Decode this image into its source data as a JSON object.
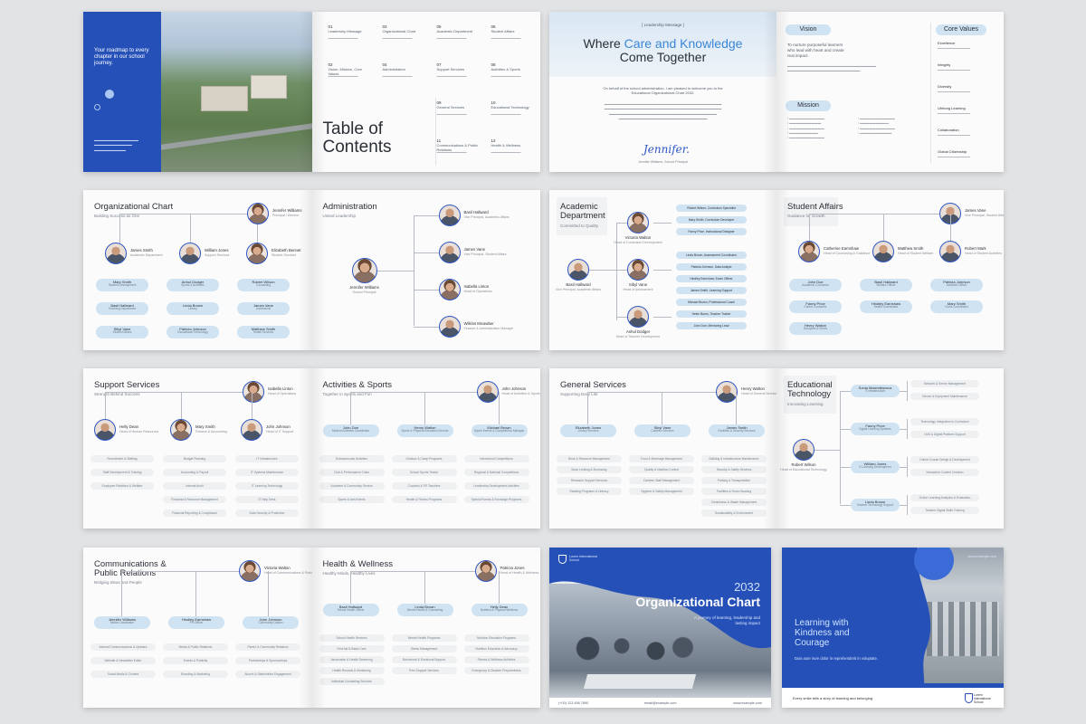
{
  "colors": {
    "accent": "#2450b8",
    "pill": "#cfe3f3",
    "background": "#e2e3e5"
  },
  "toc": {
    "tagline": "Your roadmap to every chapter in our school journey.",
    "title": "Table of Contents",
    "entries": [
      {
        "num": "01",
        "label": "Leadership Message"
      },
      {
        "num": "02",
        "label": "Vision, Mission, Core Values"
      },
      {
        "num": "03",
        "label": "Organizational Chart"
      },
      {
        "num": "04",
        "label": "Administration"
      },
      {
        "num": "05",
        "label": "Academic Department"
      },
      {
        "num": "06",
        "label": "Student Affairs"
      },
      {
        "num": "07",
        "label": "Support Services"
      },
      {
        "num": "08",
        "label": "Activities & Sports"
      },
      {
        "num": "09",
        "label": "General Services"
      },
      {
        "num": "10",
        "label": "Educational Technology"
      },
      {
        "num": "11",
        "label": "Communications & Public Relations"
      },
      {
        "num": "12",
        "label": "Health & Wellness"
      }
    ]
  },
  "leadership": {
    "label": "[ Leadership Message ]",
    "heading_a": "Where ",
    "heading_b": "Care and Knowledge",
    "heading_c": "Come Together",
    "intro": "On behalf of the school administration, I am pleased to welcome you to the Educational Organizational Chart 2032.",
    "signature": "Jennifer.",
    "signer": "Jennifer Williams, School Principal"
  },
  "vision": {
    "vision_title": "Vision",
    "vision_text": "To nurture purposeful learners who lead with heart and create real impact.",
    "mission_title": "Mission",
    "core_title": "Core Values",
    "core_values": [
      "Excellence",
      "Integrity",
      "Diversity",
      "Lifelong Learning",
      "Collaboration",
      "Global Citizenship"
    ]
  },
  "org": {
    "title": "Organizational Chart",
    "sub": "Building Success as One",
    "top": {
      "name": "Jennifer Williams",
      "role": "Principal / Director"
    },
    "heads": [
      {
        "name": "James Smith",
        "role": "Academic Department"
      },
      {
        "name": "William Jones",
        "role": "Support Services"
      },
      {
        "name": "Elizabeth Bennet",
        "role": "Student Services"
      }
    ],
    "pills": [
      {
        "name": "Mary Smith",
        "role": "Student Development"
      },
      {
        "name": "Anhul Dodger",
        "role": "Sports & Activities"
      },
      {
        "name": "Robert Wilson",
        "role": "Counseling"
      },
      {
        "name": "Basil Hallward",
        "role": "Teaching Department"
      },
      {
        "name": "Linda Brown",
        "role": "Library"
      },
      {
        "name": "James Vane",
        "role": "Admissions"
      },
      {
        "name": "Sibyl Vane",
        "role": "Student Affairs"
      },
      {
        "name": "Patricia Johnson",
        "role": "Educational Technology"
      },
      {
        "name": "Matthew Smith",
        "role": "Health Services"
      }
    ]
  },
  "admin": {
    "title": "Administration",
    "sub": "United Leadership",
    "lead": {
      "name": "Jennifer Williams",
      "role": "School Principal"
    },
    "members": [
      {
        "name": "Basil Hallward",
        "role": "Vice Principal, Academic Affairs"
      },
      {
        "name": "James Vane",
        "role": "Vice Principal, Student Affairs"
      },
      {
        "name": "Isabella Linton",
        "role": "Head of Operations"
      },
      {
        "name": "Wilkins Micawber",
        "role": "Finance & Administration Manager"
      }
    ]
  },
  "academic": {
    "title": "Academic Department",
    "sub": "Committed to Quality",
    "lead": {
      "name": "Basil Hallward",
      "role": "Vice Principal, Academic Affairs"
    },
    "heads": [
      {
        "name": "Victoria Walton",
        "role": "Head of Curriculum Development"
      },
      {
        "name": "Sibyl Vane",
        "role": "Head of Assessment"
      },
      {
        "name": "Anhul Dodger",
        "role": "Head of Teacher Development"
      }
    ],
    "items": [
      "Robert Wilson, Curriculum Specialist",
      "Mary Smith, Curriculum Developer",
      "Fanny Price, Instructional Designer",
      "Linda Brown, Assessment Coordinator",
      "Patricia Johnson, Data Analyst",
      "Hindley Earnshaw, Exam Officer",
      "James Smith, Learning Support",
      "Michael Brown, Professional Coach",
      "Helen Burns, Teacher Trainer",
      "John Doe, Mentoring Lead"
    ]
  },
  "student": {
    "title": "Student Affairs",
    "sub": "Guidance for Growth",
    "lead": {
      "name": "James Vane",
      "role": "Vice Principal, Student Affairs"
    },
    "heads": [
      {
        "name": "Catherine Earnshaw",
        "role": "Head of Counseling & Guidance"
      },
      {
        "name": "Matthew Smith",
        "role": "Head of Student Welfare"
      },
      {
        "name": "Robert Mark",
        "role": "Head of Student Activities"
      }
    ],
    "pills": [
      {
        "name": "John Doe",
        "role": "Academic Counselor"
      },
      {
        "name": "Basil Hallward",
        "role": "Welfare Officer"
      },
      {
        "name": "Patricia Johnson",
        "role": "Activities Officer"
      },
      {
        "name": "Fanny Price",
        "role": "Career Counselor"
      },
      {
        "name": "Hindley Earnshaw",
        "role": "Health Coordinator"
      },
      {
        "name": "Mary Smith",
        "role": "Clubs Coordinator"
      },
      {
        "name": "Henry Walton",
        "role": "Discipline & Ethics"
      }
    ]
  },
  "support": {
    "title": "Support Services",
    "sub": "Strength Behind Success",
    "lead": {
      "name": "Isabella Linton",
      "role": "Head of Operations"
    },
    "heads": [
      {
        "name": "Helly Dean",
        "role": "Head of Human Resources"
      },
      {
        "name": "Mary Smith",
        "role": "Finance & Accounting"
      },
      {
        "name": "John Johnson",
        "role": "Head of IT Support"
      }
    ],
    "items": [
      "Recruitment & Staffing",
      "Staff Development & Training",
      "Employee Relations & Welfare",
      "Budget Planning",
      "Accounting & Payroll",
      "Internal Audit",
      "Financial & Resource Management",
      "Financial Reporting & Compliance",
      "IT Infrastructure",
      "IT Systems Maintenance",
      "IT Learning Technology",
      "IT Help Desk",
      "Data Security & Protection"
    ]
  },
  "activities": {
    "title": "Activities & Sports",
    "sub": "Together in Sports and Fun",
    "lead": {
      "name": "John Johnson",
      "role": "Head of Activities & Sports"
    },
    "pills": [
      {
        "name": "John Doe",
        "role": "Student Activities Coordinator"
      },
      {
        "name": "Henry Walton",
        "role": "Sports & Physical Education Director"
      },
      {
        "name": "Michael Brown",
        "role": "Sports Events & Competitions Manager"
      }
    ],
    "items": [
      "Extracurricular Activities",
      "Club & Performance Clubs",
      "Volunteer & Community Service",
      "Sports & Arts Events",
      "Outdoor & Camp Programs",
      "School Sports Teams",
      "Coaches & PE Teachers",
      "Health & Fitness Programs",
      "Interschool Competitions",
      "Regional & National Competitions",
      "Leadership Development Activities",
      "Special Events & Exchange Programs"
    ]
  },
  "general": {
    "title": "General Services",
    "sub": "Supporting Daily Life",
    "lead": {
      "name": "Henry Walton",
      "role": "Head of General Services"
    },
    "pills": [
      {
        "name": "Elizabeth Jones",
        "role": "Library Services"
      },
      {
        "name": "Sibyl Vane",
        "role": "Canteen Services"
      },
      {
        "name": "James Smith",
        "role": "Facilities & Security Services"
      }
    ],
    "items": [
      "Book & Resource Management",
      "Book Lending & Borrowing",
      "Research Support Services",
      "Reading Programs & Literacy",
      "Food & Beverage Management",
      "Quality & Nutrition Control",
      "Canteen Staff Management",
      "Hygiene & Safety Management",
      "Building & Infrastructure Maintenance",
      "Security & Safety Services",
      "Parking & Transportation",
      "Facilities & Room Booking",
      "Cleanliness & Waste Management",
      "Sustainability & Environment"
    ]
  },
  "edtech": {
    "title": "Educational Technology",
    "sub": "Innovating Learning",
    "lead": {
      "name": "Robert Wilson",
      "role": "Head of Educational Technology"
    },
    "pills": [
      {
        "name": "Sonia Maximillanova",
        "role": "IT Infrastructure"
      },
      {
        "name": "Fanny Price",
        "role": "Digital Learning Systems"
      },
      {
        "name": "William Jones",
        "role": "E-Learning Development"
      },
      {
        "name": "Linda Brown",
        "role": "Teacher Technology Support"
      }
    ],
    "items": [
      "Network & Server Management",
      "Device & Equipment Maintenance",
      "Technology Integration in Curriculum",
      "LMS & Digital Platform Support",
      "Online Course Design & Development",
      "Interactive Content Creation",
      "Online Learning Analytics & Evaluation",
      "Teacher Digital Skills Training",
      "Technology Helpdesk & Support",
      "EdTech Research & Innovation"
    ]
  },
  "comms": {
    "title": "Communications & Public Relations",
    "sub": "Bridging Ideas and People",
    "lead": {
      "name": "Victoria Walton",
      "role": "Head of Communications & Public Relations"
    },
    "pills": [
      {
        "name": "Jennifer Williams",
        "role": "Media Coordinator"
      },
      {
        "name": "Hindley Earnshaw",
        "role": "PR Officer"
      },
      {
        "name": "John Johnson",
        "role": "Community Liaison"
      }
    ],
    "items": [
      "Internal Communications & Updates",
      "Website & Newsletter Editor",
      "Social Media & Content",
      "Media & Public Relations",
      "Events & Publicity",
      "Branding & Marketing",
      "Parent & Community Relations",
      "Partnerships & Sponsorships",
      "Alumni & Stakeholder Engagement"
    ]
  },
  "health": {
    "title": "Health & Wellness",
    "sub": "Healthy Minds, Healthy Lives",
    "lead": {
      "name": "Patricia Jones",
      "role": "Head of Health & Wellness"
    },
    "pills": [
      {
        "name": "Basil Hallward",
        "role": "School Health Officer"
      },
      {
        "name": "Linda Brown",
        "role": "Mental Health & Counseling"
      },
      {
        "name": "Helly Dean",
        "role": "Nutrition & Physical Wellness"
      }
    ],
    "items": [
      "School Health Services",
      "First Aid & Basic Care",
      "Vaccination & Health Screening",
      "Health Records & Monitoring",
      "Individual Counseling Services",
      "Mental Health Programs",
      "Stress Management",
      "Behavioral & Emotional Support",
      "Peer Support Services",
      "Nutrition Education Programs",
      "Nutrition Education & Advocacy",
      "Fitness & Wellness Activities",
      "Emergency & Disaster Preparedness"
    ]
  },
  "cover": {
    "school_name": "Lorem International School",
    "year": "2032",
    "title": "Organizational Chart",
    "subtitle": "A journey of learning, leadership and lasting impact",
    "phone": "(+00) 123 456 7890",
    "email": "email@example.com",
    "website": "www.example.com"
  },
  "back": {
    "website": "www.example.com",
    "heading": "Learning with Kindness and Courage",
    "text": "Duis aute irure dolor in reprehenderit in voluptate.",
    "footer": "Every smile tells a story of learning and belonging",
    "school_name": "Lorem International School"
  }
}
